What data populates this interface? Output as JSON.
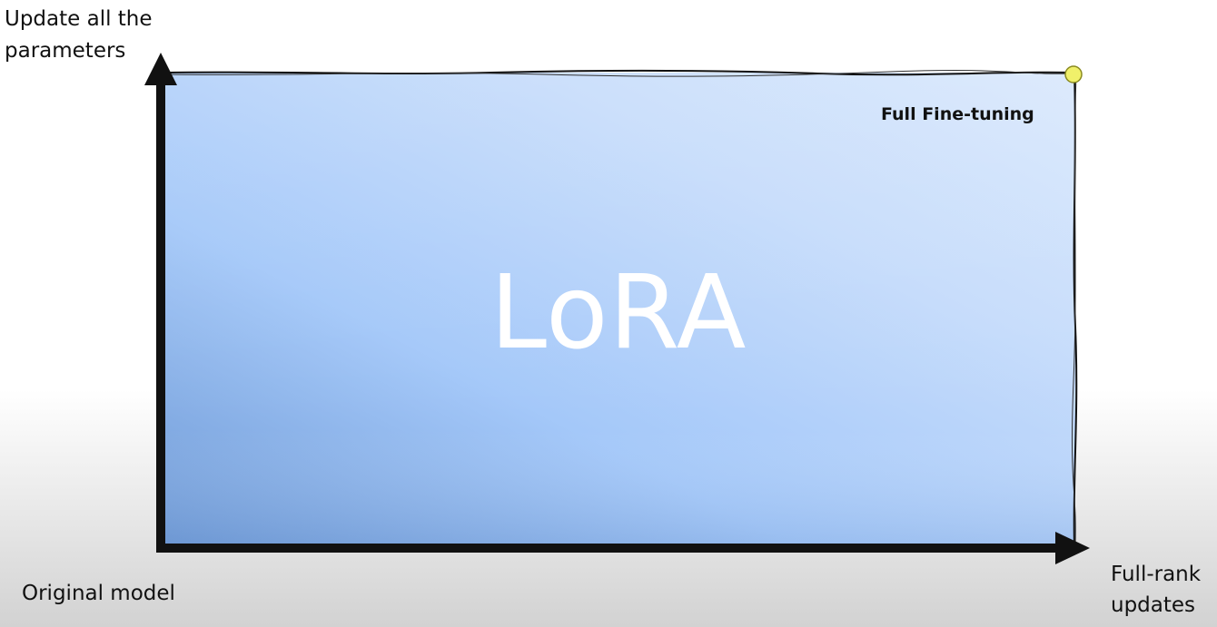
{
  "diagram": {
    "y_axis_label": "Update all the parameters",
    "x_axis_label": "Full-rank updates",
    "origin_label": "Original model",
    "region_label": "LoRA",
    "point_label": "Full Fine-tuning",
    "colors": {
      "region_light": "#d7e6fb",
      "region_mid": "#a8ccfa",
      "region_dark": "#6f9ad6",
      "axis": "#111111",
      "point_fill": "#f0f06a",
      "point_stroke": "#8a8a20"
    }
  }
}
